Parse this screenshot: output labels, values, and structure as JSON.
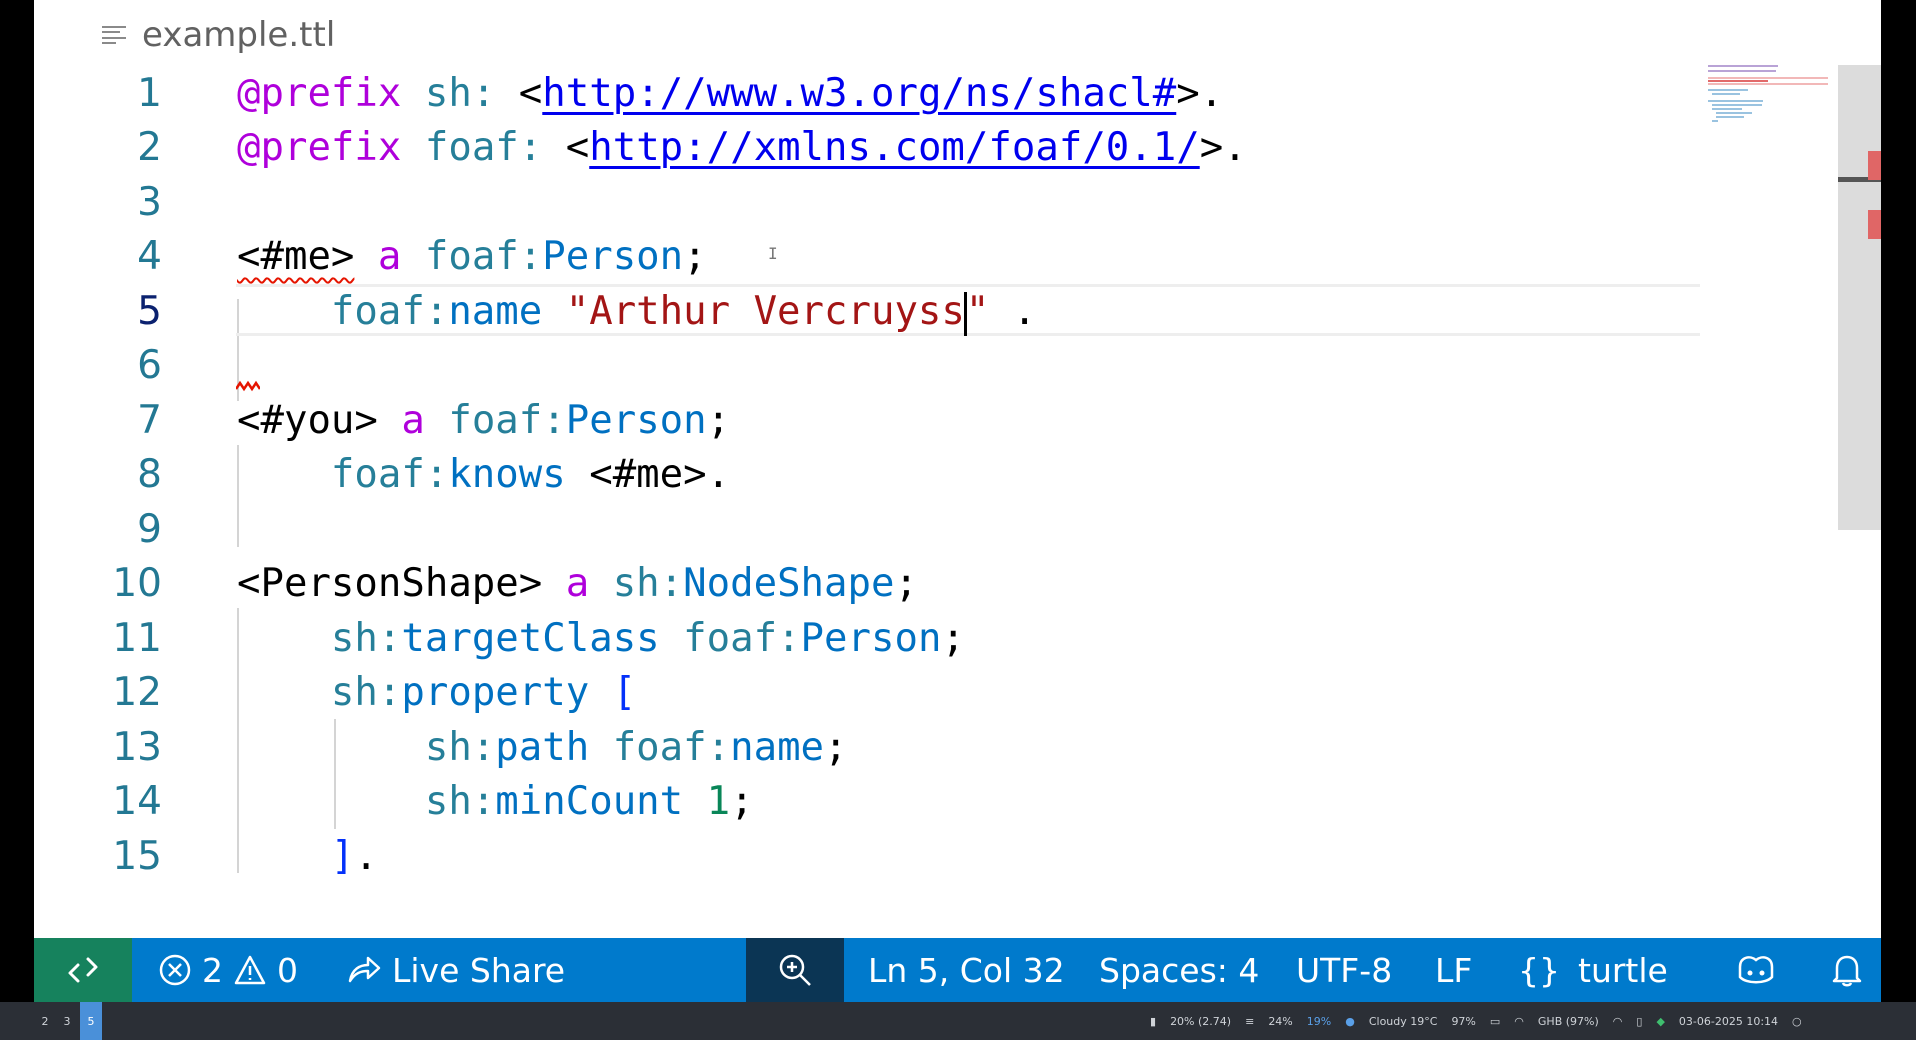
{
  "editor": {
    "filename": "example.ttl",
    "lines": [
      {
        "n": "1"
      },
      {
        "n": "2"
      },
      {
        "n": "3"
      },
      {
        "n": "4"
      },
      {
        "n": "5"
      },
      {
        "n": "6"
      },
      {
        "n": "7"
      },
      {
        "n": "8"
      },
      {
        "n": "9"
      },
      {
        "n": "10"
      },
      {
        "n": "11"
      },
      {
        "n": "12"
      },
      {
        "n": "13"
      },
      {
        "n": "14"
      },
      {
        "n": "15"
      }
    ],
    "tokens": {
      "l1": {
        "kw": "@prefix",
        "pfx": "sh:",
        "lt": "<",
        "url": "http://www.w3.org/ns/shacl#",
        "end": ">."
      },
      "l2": {
        "kw": "@prefix",
        "pfx": "foaf:",
        "lt": "<",
        "url": "http://xmlns.com/foaf/0.1/",
        "end": ">."
      },
      "l4": {
        "subj": "<#me>",
        "a": "a",
        "pfx": "foaf:",
        "local": "Person",
        "end": ";"
      },
      "l5": {
        "pfx": "foaf:",
        "local": "name",
        "str_before_cursor": "\"Arthur Vercruyss",
        "str_after_cursor": "\"",
        "end": "."
      },
      "l7": {
        "subj": "<#you>",
        "a": "a",
        "pfx": "foaf:",
        "local": "Person",
        "end": ";"
      },
      "l8": {
        "pfx": "foaf:",
        "local": "knows",
        "obj": "<#me>",
        "end": "."
      },
      "l10": {
        "subj": "<PersonShape>",
        "a": "a",
        "pfx": "sh:",
        "local": "NodeShape",
        "end": ";"
      },
      "l11": {
        "pfx": "sh:",
        "local": "targetClass",
        "pfx2": "foaf:",
        "local2": "Person",
        "end": ";"
      },
      "l12": {
        "pfx": "sh:",
        "local": "property",
        "bracket": "["
      },
      "l13": {
        "pfx": "sh:",
        "local": "path",
        "pfx2": "foaf:",
        "local2": "name",
        "end": ";"
      },
      "l14": {
        "pfx": "sh:",
        "local": "minCount",
        "num": "1",
        "end": ";"
      },
      "l15": {
        "bracket": "]",
        "end": "."
      }
    }
  },
  "statusbar": {
    "errors": "2",
    "warnings": "0",
    "live_share": "Live Share",
    "cursor_pos": "Ln 5, Col 32",
    "indent": "Spaces: 4",
    "encoding": "UTF-8",
    "eol": "LF",
    "language_braces": "{}",
    "language": "turtle",
    "colors": {
      "bg": "#007acc",
      "remote_bg": "#16825d",
      "zoom_bg": "#0b3554"
    }
  },
  "taskbar": {
    "workspaces": [
      "2",
      "3",
      "5"
    ],
    "active_workspace": "5",
    "tray": {
      "cpu": "20% (2.74)",
      "mem": "24%",
      "net": "19%",
      "weather": "Cloudy 19°C",
      "battery": "97%",
      "wifi": "GHB (97%)",
      "datetime": "03-06-2025 10:14"
    }
  }
}
